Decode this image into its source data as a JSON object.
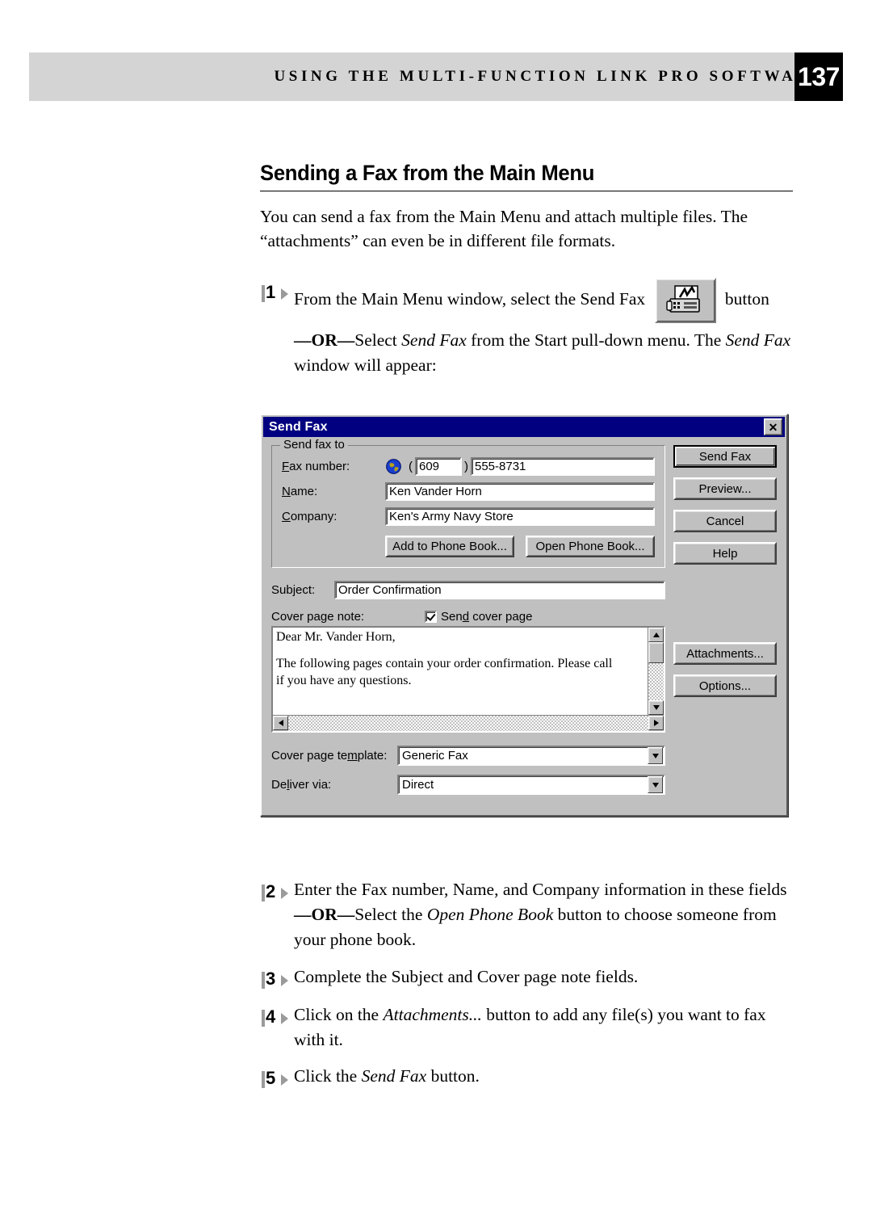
{
  "header": {
    "running_title": "USING THE MULTI-FUNCTION LINK PRO SOFTWARE",
    "page_number": "137"
  },
  "section": {
    "heading": "Sending a Fax from the Main Menu",
    "intro": "You can send a fax from the Main Menu and attach multiple files. The “attachments” can even be in different file formats."
  },
  "steps": {
    "step1": {
      "number": "1",
      "text_before_icon": "From the Main Menu window, select the Send Fax",
      "icon_name": "send-fax-toolbar-icon",
      "text_after_icon": "button",
      "or_label": "—OR—",
      "or_text_a": "Select ",
      "or_italic_a": "Send Fax",
      "or_text_b": " from the Start pull-down menu.  The ",
      "or_italic_b": "Send Fax",
      "or_text_c": " window will appear:"
    },
    "step2": {
      "number": "2",
      "line1": "Enter the Fax number, Name, and Company information in these fields",
      "or_label": "—OR—",
      "or_text_a": "Select the ",
      "or_italic_a": "Open Phone Book",
      "or_text_b": " button to choose someone from your phone book."
    },
    "step3": {
      "number": "3",
      "line1": "Complete the Subject and Cover page note fields."
    },
    "step4": {
      "number": "4",
      "text_a": "Click on the ",
      "italic_a": "Attachments...",
      "text_b": " button to add any file(s) you want to fax with it."
    },
    "step5": {
      "number": "5",
      "text_a": "Click the ",
      "italic_a": "Send Fax",
      "text_b": " button."
    }
  },
  "dialog": {
    "title": "Send Fax",
    "close_label": "✕",
    "group_send_fax_to": {
      "legend": "Send fax to",
      "fax_number_label": "Fax number:",
      "fax_number_accel": "F",
      "area_code_open_paren": "(",
      "area_code_value": "609",
      "area_code_close_paren": ")",
      "fax_number_value": "555-8731",
      "name_label": "Name:",
      "name_accel": "N",
      "name_value": "Ken Vander Horn",
      "company_label": "Company:",
      "company_accel": "C",
      "company_value": "Ken's Army Navy Store",
      "add_to_phone_book": "Add to Phone Book...",
      "open_phone_book": "Open Phone Book..."
    },
    "subject_label": "Subject:",
    "subject_value": "Order Confirmation",
    "cover_page_note_label": "Cover page note:",
    "send_cover_page_label": "Send cover page",
    "send_cover_page_checked": true,
    "cover_note_line1": "Dear Mr. Vander Horn,",
    "cover_note_line2": "The following pages contain your order confirmation.  Please call",
    "cover_note_line3": "if you have any questions.",
    "cover_page_template_label": "Cover page template:",
    "cover_page_template_value": "Generic Fax",
    "deliver_via_label": "Deliver via:",
    "deliver_via_value": "Direct",
    "buttons": {
      "send_fax": "Send Fax",
      "preview": "Preview...",
      "cancel": "Cancel",
      "help": "Help",
      "attachments": "Attachments...",
      "options": "Options..."
    },
    "colors": {
      "titlebar": "#000080",
      "face": "#c0c0c0",
      "field_bg": "#ffffff"
    }
  }
}
